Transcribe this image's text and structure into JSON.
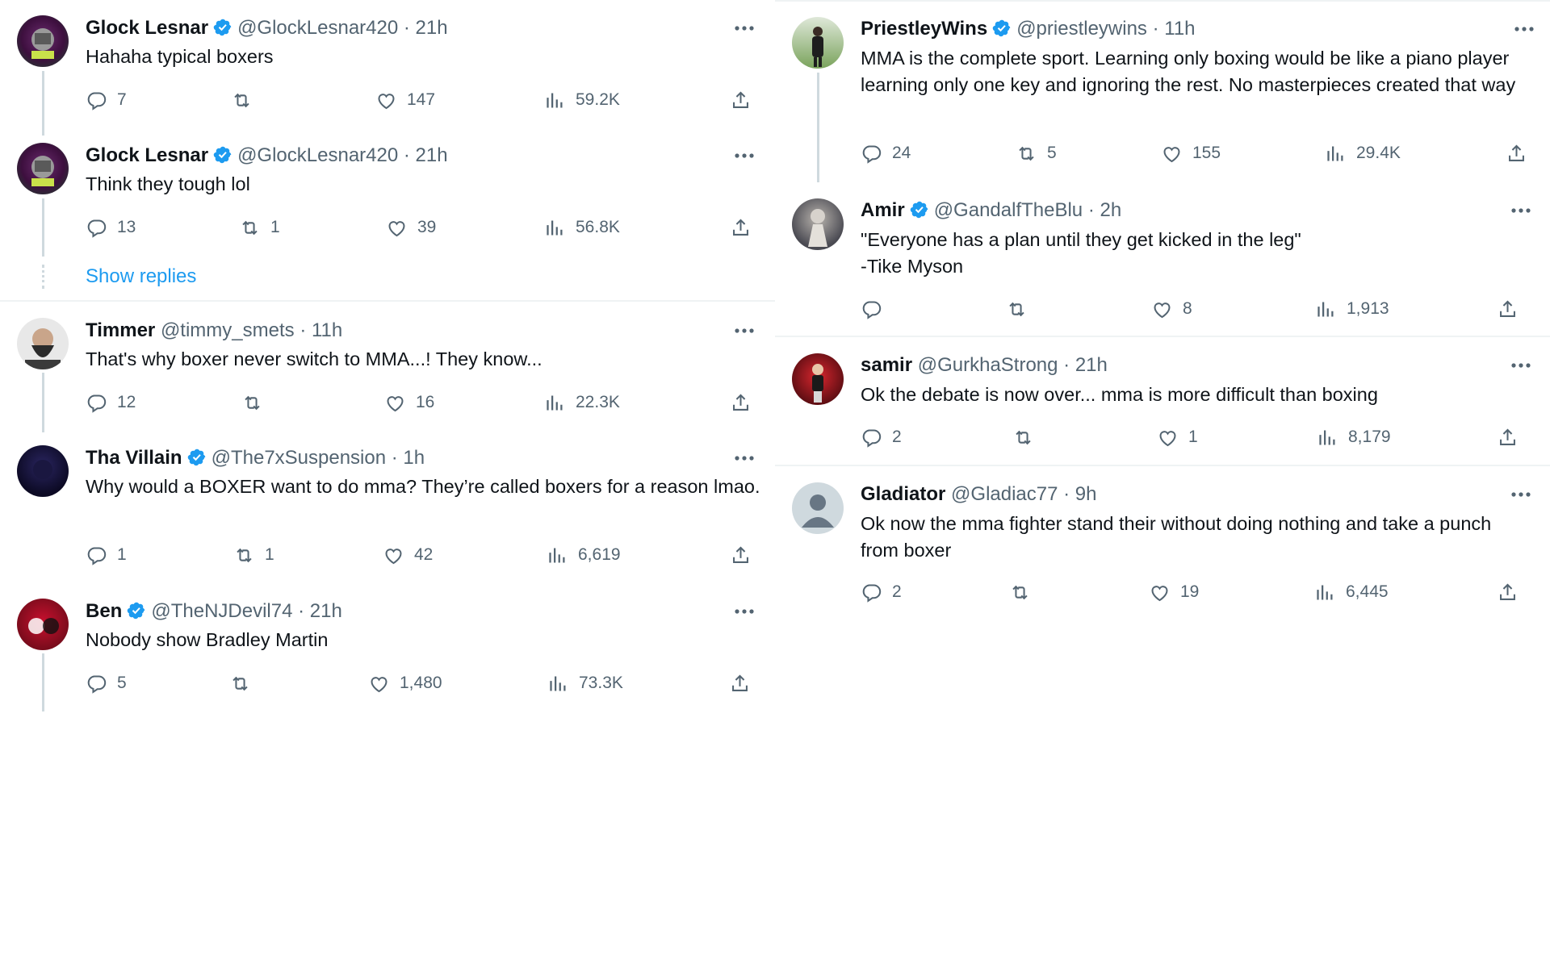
{
  "left_column": {
    "tweets": [
      {
        "name": "Glock Lesnar",
        "verified": true,
        "handle": "@GlockLesnar420",
        "time": "· 21h",
        "text": "Hahaha typical boxers",
        "replies": "7",
        "reposts": "",
        "likes": "147",
        "views": "59.2K"
      },
      {
        "name": "Glock Lesnar",
        "verified": true,
        "handle": "@GlockLesnar420",
        "time": "· 21h",
        "text": "Think they tough lol",
        "replies": "13",
        "reposts": "1",
        "likes": "39",
        "views": "56.8K"
      },
      {
        "name": "Timmer",
        "verified": false,
        "handle": "@timmy_smets",
        "time": "· 11h",
        "text": "That's why boxer never switch to MMA...! They know...",
        "replies": "12",
        "reposts": "",
        "likes": "16",
        "views": "22.3K"
      },
      {
        "name": "Tha Villain",
        "verified": true,
        "handle": "@The7xSuspension",
        "time": "· 1h",
        "text": "Why would a BOXER want to do mma? They’re called boxers for a reason lmao.",
        "replies": "1",
        "reposts": "1",
        "likes": "42",
        "views": "6,619"
      },
      {
        "name": "Ben",
        "verified": true,
        "handle": "@TheNJDevil74",
        "time": "· 21h",
        "text": "Nobody show Bradley Martin",
        "replies": "5",
        "reposts": "",
        "likes": "1,480",
        "views": "73.3K"
      }
    ],
    "show_replies_label": "Show replies"
  },
  "right_column": {
    "tweets": [
      {
        "name": "PriestleyWins",
        "verified": true,
        "handle": "@priestleywins",
        "time": "· 11h",
        "text": "MMA is the complete sport. Learning only boxing would be like a piano player learning only one key and ignoring the rest. No masterpieces created that way",
        "replies": "24",
        "reposts": "5",
        "likes": "155",
        "views": "29.4K"
      },
      {
        "name": "Amir",
        "verified": true,
        "handle": "@GandalfTheBlu",
        "time": "· 2h",
        "text": "\"Everyone has a plan until they get kicked in the leg\"\n-Tike Myson",
        "replies": "",
        "reposts": "",
        "likes": "8",
        "views": "1,913"
      },
      {
        "name": "samir",
        "verified": false,
        "handle": "@GurkhaStrong",
        "time": "· 21h",
        "text": "Ok the debate is now over... mma is more difficult than boxing",
        "replies": "2",
        "reposts": "",
        "likes": "1",
        "views": "8,179"
      },
      {
        "name": "Gladiator",
        "verified": false,
        "handle": "@Gladiac77",
        "time": "· 9h",
        "text": "Ok now the mma fighter stand their without doing nothing and take a punch from boxer",
        "replies": "2",
        "reposts": "",
        "likes": "19",
        "views": "6,445"
      }
    ]
  },
  "icons": {
    "reply": "reply-icon",
    "repost": "repost-icon",
    "like": "like-icon",
    "views": "views-icon",
    "share": "share-icon",
    "more": "more-icon",
    "verified": "verified-badge-icon"
  },
  "colors": {
    "verified_blue": "#1d9bf0",
    "secondary_text": "#536471",
    "link_blue": "#1d9bf0"
  }
}
